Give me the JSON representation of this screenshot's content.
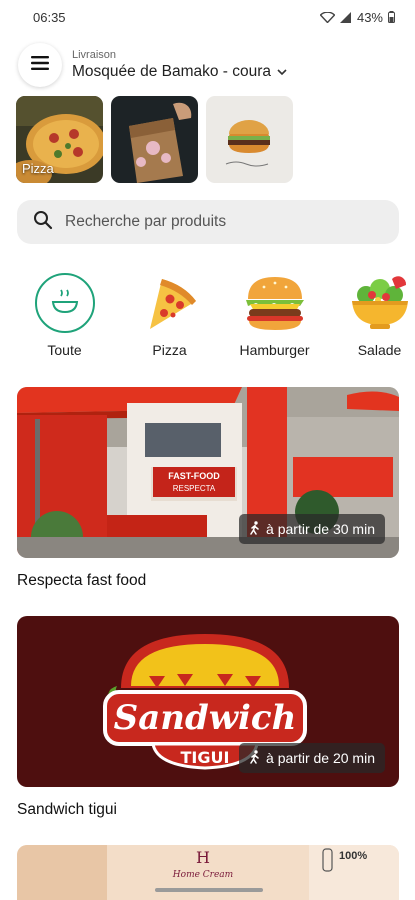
{
  "status_bar": {
    "time": "06:35",
    "battery": "43%"
  },
  "header": {
    "delivery_label": "Livraison",
    "address": "Mosquée de Bamako - coura"
  },
  "stories": [
    {
      "label": "Pizza"
    },
    {
      "label": ""
    },
    {
      "label": ""
    }
  ],
  "search": {
    "placeholder": "Recherche par produits"
  },
  "categories": [
    {
      "label": "Toute",
      "icon": "bowl-icon"
    },
    {
      "label": "Pizza",
      "icon": "pizza-icon"
    },
    {
      "label": "Hamburger",
      "icon": "hamburger-icon"
    },
    {
      "label": "Salade",
      "icon": "salad-icon"
    }
  ],
  "restaurants": [
    {
      "name": "Respecta fast food",
      "time": "à partir de 30 min",
      "sign_line1": "FAST-FOOD",
      "sign_line2": "RESPECTA"
    },
    {
      "name": "Sandwich tigui",
      "time": "à partir de 20 min",
      "logo_word": "Sandwich",
      "logo_sub": "TIGUI"
    },
    {
      "name": "",
      "time": "",
      "brand": "Home Cream",
      "badge": "100%"
    }
  ],
  "colors": {
    "accent": "#1fa37a",
    "logo_bg": "#4e0f0f",
    "logo_yellow": "#f2c21a",
    "logo_red": "#c8281e"
  }
}
